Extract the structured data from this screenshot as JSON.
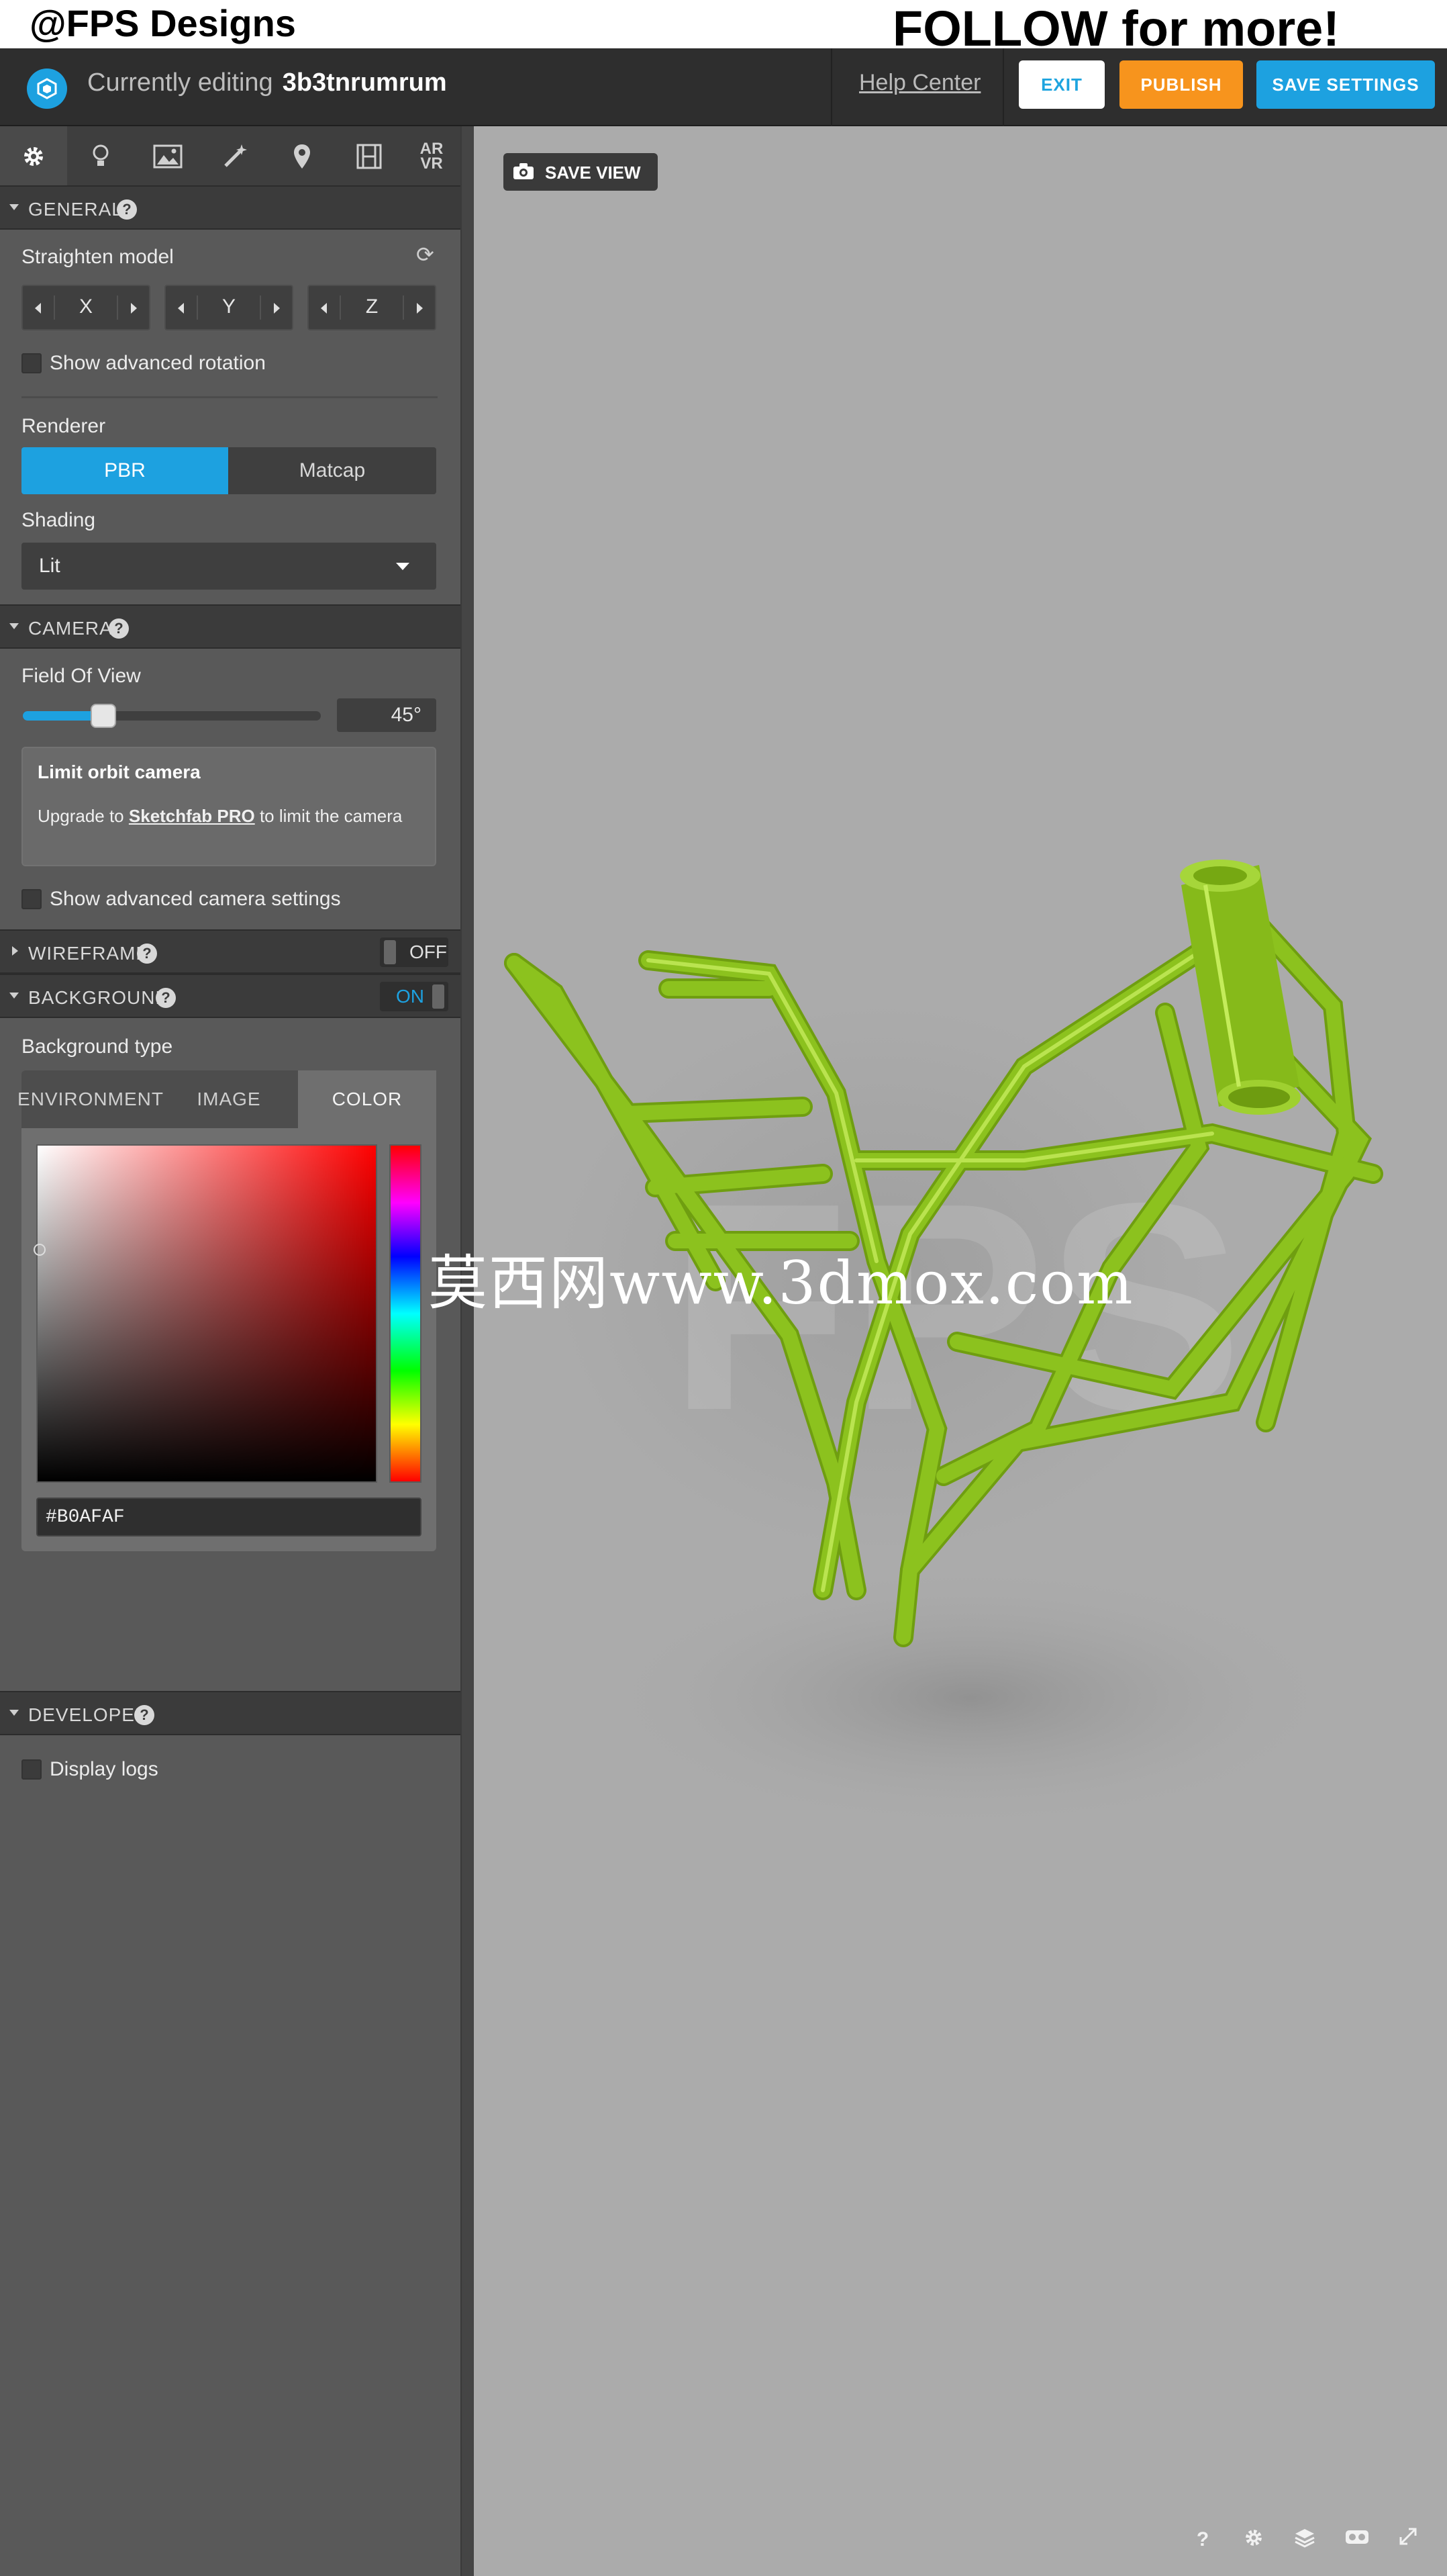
{
  "caption": {
    "left": "@FPS Designs",
    "right": "FOLLOW for more!"
  },
  "header": {
    "editing_prefix": "Currently editing",
    "model_name": "3b3tnrumrum",
    "help_center": "Help Center",
    "exit": "EXIT",
    "publish": "PUBLISH",
    "save_settings": "SAVE SETTINGS",
    "colors": {
      "accent": "#1da1e0",
      "publish": "#f7941d",
      "header_bg": "#2e2e2e"
    }
  },
  "sidebar": {
    "tabs": [
      {
        "icon": "gear-icon",
        "active": true
      },
      {
        "icon": "lightbulb-icon"
      },
      {
        "icon": "image-icon"
      },
      {
        "icon": "magic-wand-icon"
      },
      {
        "icon": "map-pin-icon"
      },
      {
        "icon": "film-icon"
      },
      {
        "icon": "ar-vr-icon",
        "text": "AR VR"
      }
    ],
    "ar_label": "AR",
    "vr_label": "VR",
    "general": {
      "title": "GENERAL",
      "straighten_label": "Straighten model",
      "axes": [
        "X",
        "Y",
        "Z"
      ],
      "advanced_rotation": "Show advanced rotation",
      "renderer_label": "Renderer",
      "renderer_options": [
        "PBR",
        "Matcap"
      ],
      "renderer_selected": "PBR",
      "shading_label": "Shading",
      "shading_value": "Lit"
    },
    "camera": {
      "title": "CAMERA",
      "fov_label": "Field Of View",
      "fov_value": "45°",
      "fov_fraction": 0.27,
      "limit_title": "Limit orbit camera",
      "limit_text_pre": "Upgrade to",
      "limit_link": "Sketchfab PRO",
      "limit_text_post": "to limit the camera",
      "advanced_camera": "Show advanced camera settings"
    },
    "wireframe": {
      "title": "WIREFRAME",
      "state": "OFF"
    },
    "background": {
      "title": "BACKGROUND",
      "state": "ON",
      "type_label": "Background type",
      "types": [
        "ENVIRONMENT",
        "IMAGE",
        "COLOR"
      ],
      "selected_type": "COLOR",
      "hex_value": "#B0AFAF"
    },
    "developer": {
      "title": "DEVELOPER",
      "display_logs": "Display logs"
    }
  },
  "viewport": {
    "save_view": "SAVE VIEW",
    "model_color": "#8cc21e",
    "background_color": "#ababab",
    "watermark": "莫西网www.3dmox.com",
    "faint_text": "FPS",
    "bottom_help": "?",
    "bottom_icons": [
      "help-icon",
      "settings-gear-icon",
      "layers-icon",
      "vr-headset-icon",
      "fullscreen-icon"
    ]
  }
}
